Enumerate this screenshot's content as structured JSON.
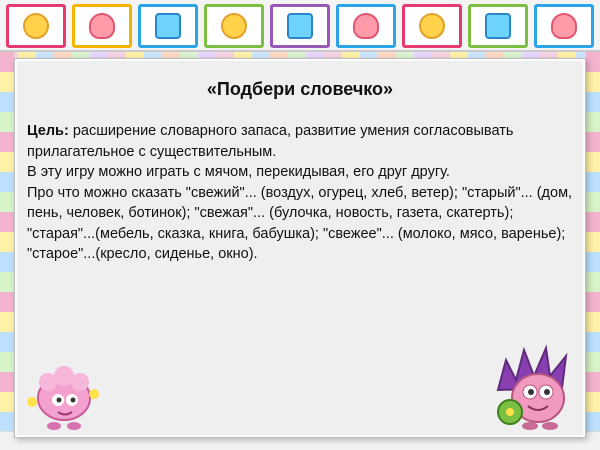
{
  "slide": {
    "title": "«Подбери словечко»",
    "goal_label": "Цель:",
    "goal_text": " расширение словарного запаса, развитие умения согласовывать прилагательное с существительным.",
    "line2": "В эту игру можно играть с мячом, перекидывая, его друг другу.",
    "line3": "Про что можно сказать \"свежий\"... (воздух, огурец, хлеб, ветер); \"старый\"... (дом, пень, человек, ботинок); \"свежая\"... (булочка, новость, газета, скатерть); \"старая\"...(мебель, сказка, книга, бабушка); \"свежее\"... (молоко, мясо, варенье); \"старое\"...(кресло, сиденье, окно)."
  },
  "decor": {
    "top_strip_icons": [
      "animal-tile-icon",
      "ball-tile-icon",
      "letter-tile-icon",
      "bird-tile-icon",
      "duck-tile-icon",
      "bear-tile-icon",
      "flower-tile-icon",
      "tile-icon"
    ],
    "characters": [
      "sheep-character-icon",
      "hedgehog-character-icon"
    ],
    "colors": {
      "slide_bg": "#efefef",
      "frame_pink": "#e63b6e",
      "frame_yellow": "#f4b400",
      "frame_blue": "#2aa5e6"
    }
  }
}
